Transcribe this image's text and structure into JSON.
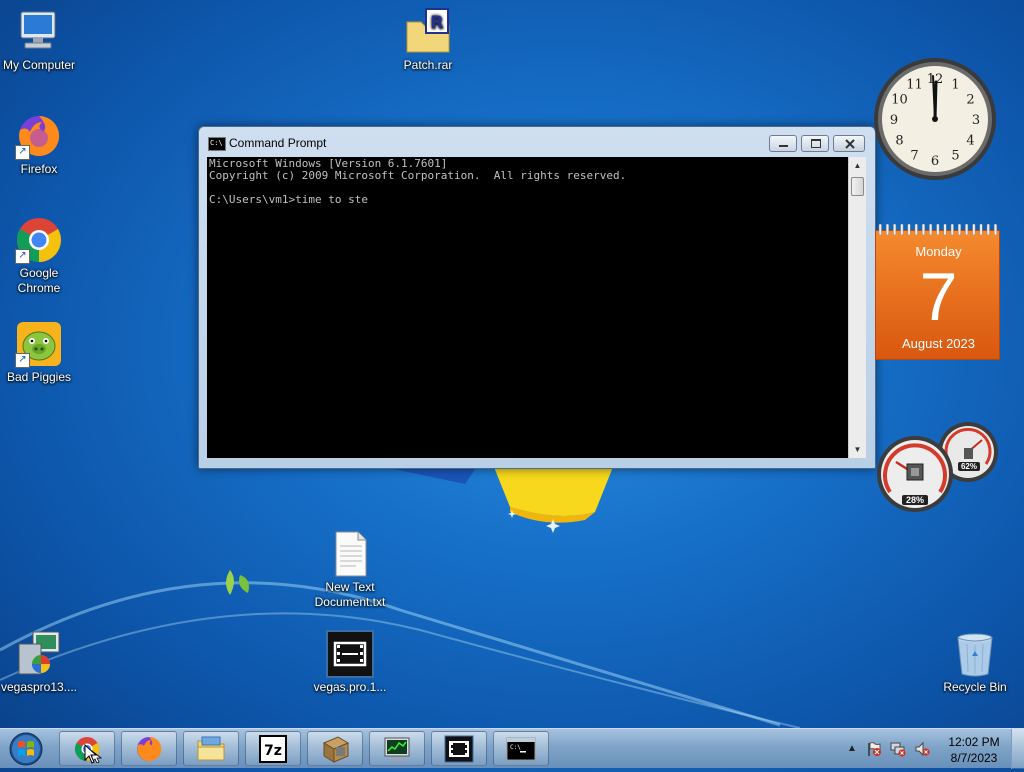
{
  "desktop": {
    "icons": [
      {
        "label": "My Computer"
      },
      {
        "label": "Patch.rar"
      },
      {
        "label": "Firefox"
      },
      {
        "label": "Google Chrome"
      },
      {
        "label": "Bad Piggies"
      },
      {
        "label": "New Text Document.txt"
      },
      {
        "label": "vegaspro13...."
      },
      {
        "label": "vegas.pro.1..."
      },
      {
        "label": "Recycle Bin"
      }
    ]
  },
  "cmd_window": {
    "title": "Command Prompt",
    "lines": [
      "Microsoft Windows [Version 6.1.7601]",
      "Copyright (c) 2009 Microsoft Corporation.  All rights reserved.",
      "",
      "C:\\Users\\vm1>time to ste"
    ]
  },
  "gadgets": {
    "clock": {
      "hour_numbers": [
        "12",
        "1",
        "2",
        "3",
        "4",
        "5",
        "6",
        "7",
        "8",
        "9",
        "10",
        "11"
      ]
    },
    "calendar": {
      "day_name": "Monday",
      "day_number": "7",
      "month_year": "August 2023"
    },
    "cpu_meter": {
      "cpu_percent": "28%",
      "memory_percent": "62%"
    }
  },
  "taskbar": {
    "clock_time": "12:02 PM",
    "clock_date": "8/7/2023",
    "buttons": [
      {
        "name": "chrome"
      },
      {
        "name": "firefox"
      },
      {
        "name": "file-explorer"
      },
      {
        "name": "7zip"
      },
      {
        "name": "installer"
      },
      {
        "name": "task-manager"
      },
      {
        "name": "vegas"
      },
      {
        "name": "command-prompt"
      }
    ]
  },
  "colors": {
    "accent": "#1770c8",
    "calendar_orange": "#e8661b",
    "console_bg": "#000000",
    "console_text": "#c0c0c0"
  }
}
